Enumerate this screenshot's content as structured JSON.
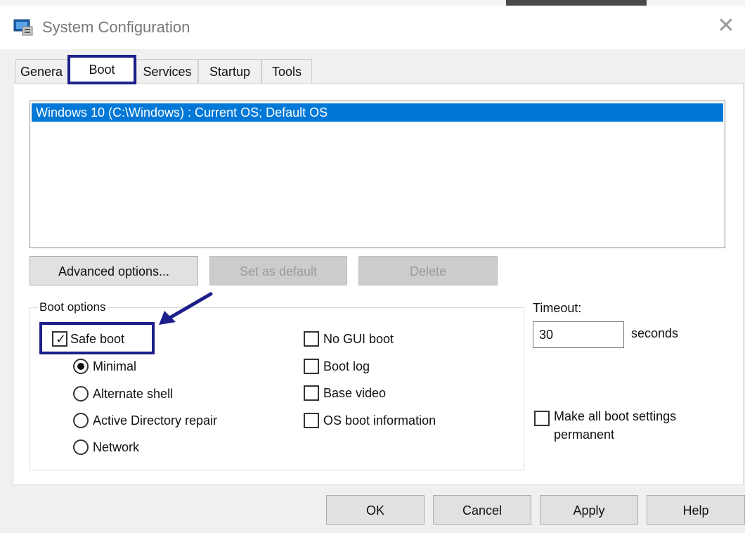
{
  "window": {
    "title": "System Configuration",
    "close_glyph": "✕"
  },
  "tabs": [
    {
      "label": "General",
      "visible_label": "Genera"
    },
    {
      "label": "Boot"
    },
    {
      "label": "Services"
    },
    {
      "label": "Startup"
    },
    {
      "label": "Tools"
    }
  ],
  "active_tab": "Boot",
  "os_list": [
    "Windows 10 (C:\\Windows) : Current OS; Default OS"
  ],
  "buttons": {
    "advanced": "Advanced options...",
    "set_default": "Set as default",
    "delete": "Delete"
  },
  "boot_options": {
    "legend": "Boot options",
    "safe_boot": {
      "label": "Safe boot",
      "checked": true
    },
    "safe_boot_modes": [
      {
        "label": "Minimal",
        "selected": true
      },
      {
        "label": "Alternate shell",
        "selected": false
      },
      {
        "label": "Active Directory repair",
        "selected": false
      },
      {
        "label": "Network",
        "selected": false
      }
    ],
    "extra": [
      {
        "label": "No GUI boot",
        "checked": false
      },
      {
        "label": "Boot log",
        "checked": false
      },
      {
        "label": "Base video",
        "checked": false
      },
      {
        "label": "OS boot information",
        "checked": false
      }
    ]
  },
  "timeout": {
    "label": "Timeout:",
    "value": "30",
    "unit": "seconds"
  },
  "permanent": {
    "label_line1": "Make all boot settings",
    "label_line2": "permanent",
    "checked": false
  },
  "footer": {
    "ok": "OK",
    "cancel": "Cancel",
    "apply": "Apply",
    "help": "Help"
  },
  "colors": {
    "accent": "#0078d7",
    "annotation": "#1c1f8a"
  },
  "icons": {
    "app": "system-config-icon",
    "close": "close-icon",
    "arrow": "annotation-arrow"
  }
}
